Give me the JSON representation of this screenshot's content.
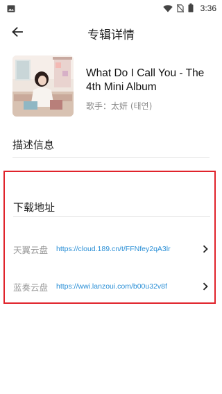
{
  "status_bar": {
    "time": "3:36",
    "icons": [
      "image-icon",
      "wifi-icon",
      "no-sim-icon",
      "battery-icon"
    ]
  },
  "header": {
    "title": "专辑详情",
    "back_icon": "arrow-left-icon"
  },
  "album": {
    "title": "What Do I Call You - The 4th Mini Album",
    "artist_label": "歌手：",
    "artist_name": "太妍 (태연)"
  },
  "description": {
    "heading": "描述信息"
  },
  "downloads": {
    "heading": "下载地址",
    "highlight_color": "#e0232b",
    "link_color": "#2a8fd6",
    "items": [
      {
        "label": "天翼云盘",
        "url": "https://cloud.189.cn/t/FFNfey2qA3lr"
      },
      {
        "label": "蓝奏云盘",
        "url": "https://wwi.lanzoui.com/b00u32v8f"
      }
    ]
  }
}
